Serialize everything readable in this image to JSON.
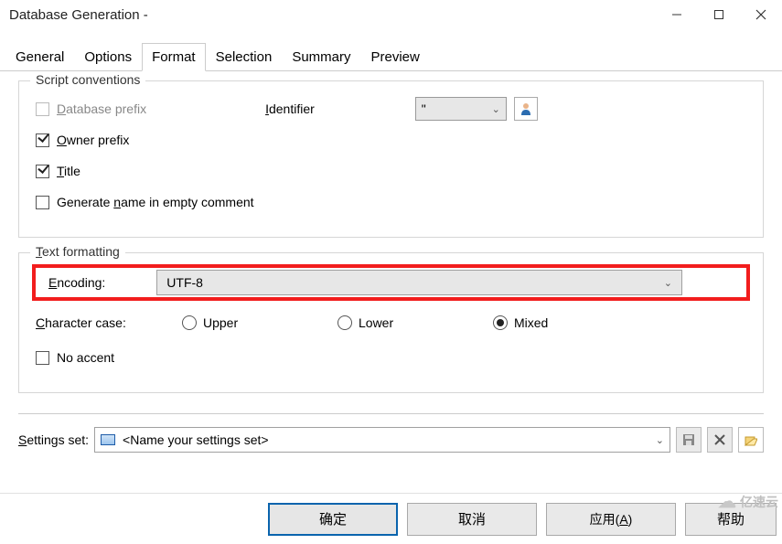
{
  "window": {
    "title": "Database Generation -"
  },
  "tabs": [
    "General",
    "Options",
    "Format",
    "Selection",
    "Summary",
    "Preview"
  ],
  "activeTab": 2,
  "script_conv": {
    "legend": "Script conventions",
    "db_prefix": {
      "label_pre": "D",
      "label_post": "atabase prefix",
      "checked": false,
      "enabled": false
    },
    "identifier": {
      "label_pre": "I",
      "label_post": "dentifier",
      "value": "\""
    },
    "owner_prefix": {
      "label_pre": "O",
      "label_post": "wner prefix",
      "checked": true
    },
    "title": {
      "label_pre": "T",
      "label_post": "itle",
      "checked": true
    },
    "gen_name": {
      "label": "Generate ",
      "label_u": "n",
      "label_post": "ame in empty comment",
      "checked": false
    }
  },
  "text_fmt": {
    "legend_pre": "T",
    "legend_post": "ext formatting",
    "encoding": {
      "label_pre": "E",
      "label_post": "ncoding:",
      "value": "UTF-8"
    },
    "char_case": {
      "label_pre": "C",
      "label_post": "haracter case:",
      "options": [
        "Upper",
        "Lower",
        "Mixed"
      ],
      "selected": 2
    },
    "no_accent": {
      "label": "No accent",
      "checked": false
    }
  },
  "settings": {
    "label": "Settings set:",
    "placeholder": "<Name your settings set>"
  },
  "buttons": {
    "ok": "确定",
    "cancel": "取消",
    "apply": "应用(A)",
    "help": "帮助"
  },
  "watermark": "亿速云"
}
